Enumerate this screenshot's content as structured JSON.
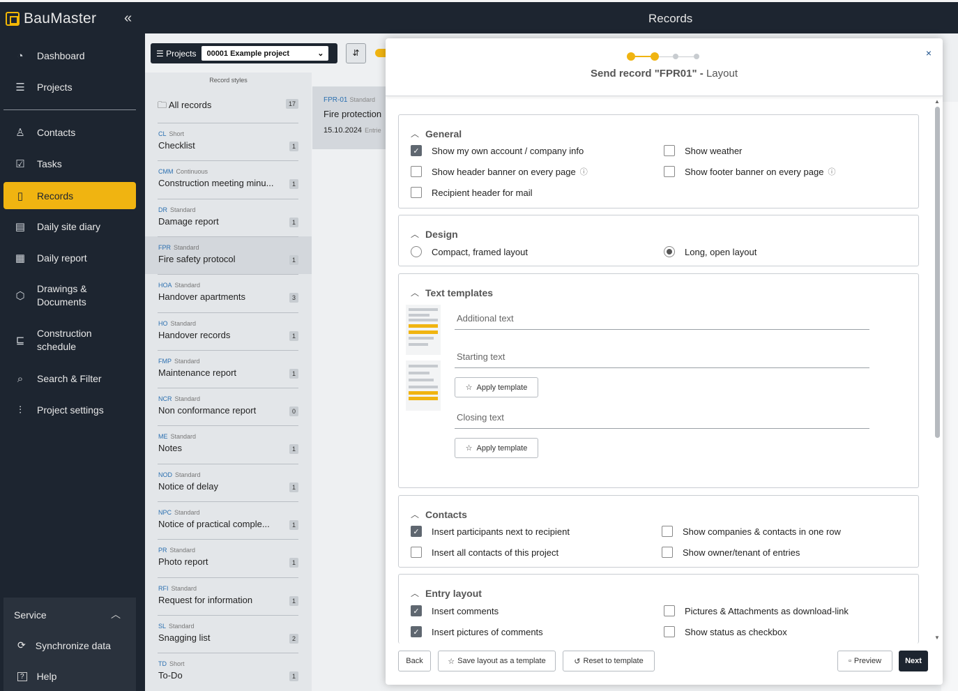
{
  "app": {
    "name": "BauMaster",
    "page_title": "Records"
  },
  "sidebar": {
    "items": [
      {
        "label": "Dashboard",
        "icon": "speedometer-icon"
      },
      {
        "label": "Projects",
        "icon": "list-icon"
      },
      {
        "label": "Contacts",
        "icon": "person-icon"
      },
      {
        "label": "Tasks",
        "icon": "clipboard-check-icon"
      },
      {
        "label": "Records",
        "icon": "clipboard-icon"
      },
      {
        "label": "Daily site diary",
        "icon": "document-icon"
      },
      {
        "label": "Daily report",
        "icon": "building-icon"
      },
      {
        "label": "Drawings &\nDocuments",
        "icon": "cube-icon"
      },
      {
        "label": "Construction\nschedule",
        "icon": "gantt-icon"
      },
      {
        "label": "Search & Filter",
        "icon": "search-document-icon"
      },
      {
        "label": "Project settings",
        "icon": "sliders-icon"
      }
    ],
    "service": {
      "label": "Service",
      "items": [
        {
          "label": "Synchronize data",
          "icon": "sync-icon"
        },
        {
          "label": "Help",
          "icon": "help-icon"
        }
      ]
    }
  },
  "toolbar": {
    "projects_label": "Projects",
    "project_value": "00001 Example project"
  },
  "record_styles": {
    "title": "Record styles",
    "all_label": "All records",
    "all_count": "17",
    "items": [
      {
        "code": "CL",
        "type": "Short",
        "name": "Checklist",
        "count": "1"
      },
      {
        "code": "CMM",
        "type": "Continuous",
        "name": "Construction meeting minu...",
        "count": "1"
      },
      {
        "code": "DR",
        "type": "Standard",
        "name": "Damage report",
        "count": "1"
      },
      {
        "code": "FPR",
        "type": "Standard",
        "name": "Fire safety protocol",
        "count": "1"
      },
      {
        "code": "HOA",
        "type": "Standard",
        "name": "Handover apartments",
        "count": "3"
      },
      {
        "code": "HO",
        "type": "Standard",
        "name": "Handover records",
        "count": "1"
      },
      {
        "code": "FMP",
        "type": "Standard",
        "name": "Maintenance report",
        "count": "1"
      },
      {
        "code": "NCR",
        "type": "Standard",
        "name": "Non conformance report",
        "count": "0"
      },
      {
        "code": "ME",
        "type": "Standard",
        "name": "Notes",
        "count": "1"
      },
      {
        "code": "NOD",
        "type": "Standard",
        "name": "Notice of delay",
        "count": "1"
      },
      {
        "code": "NPC",
        "type": "Standard",
        "name": "Notice of practical comple...",
        "count": "1"
      },
      {
        "code": "PR",
        "type": "Standard",
        "name": "Photo report",
        "count": "1"
      },
      {
        "code": "RFI",
        "type": "Standard",
        "name": "Request for information",
        "count": "1"
      },
      {
        "code": "SL",
        "type": "Standard",
        "name": "Snagging list",
        "count": "2"
      },
      {
        "code": "TD",
        "type": "Short",
        "name": "To-Do",
        "count": "1"
      }
    ]
  },
  "record_card": {
    "code": "FPR-01",
    "type": "Standard",
    "name": "Fire protection",
    "date": "15.10.2024",
    "entries": "Entrie"
  },
  "modal": {
    "title_main": "Send record \"FPR01\"",
    "title_sep": " - ",
    "title_step": "Layout",
    "close": "×",
    "general": {
      "title": "General",
      "options": [
        {
          "label": "Show my own account / company info",
          "checked": true
        },
        {
          "label": "Show weather",
          "checked": false
        },
        {
          "label": "Show header banner on every page",
          "checked": false
        },
        {
          "label": "Show footer banner on every page",
          "checked": false
        },
        {
          "label": "Recipient header for mail",
          "checked": false
        }
      ]
    },
    "design": {
      "title": "Design",
      "options": [
        {
          "label": "Compact, framed layout",
          "selected": false
        },
        {
          "label": "Long, open layout",
          "selected": true
        }
      ]
    },
    "text_templates": {
      "title": "Text templates",
      "additional_text": "Additional text",
      "starting_text": "Starting text",
      "closing_text": "Closing text",
      "apply_label": "Apply template"
    },
    "contacts": {
      "title": "Contacts",
      "options": [
        {
          "label": "Insert participants next to recipient",
          "checked": true
        },
        {
          "label": "Show companies & contacts in one row",
          "checked": false
        },
        {
          "label": "Insert all contacts of this project",
          "checked": false
        },
        {
          "label": "Show owner/tenant of entries",
          "checked": false
        }
      ]
    },
    "entry_layout": {
      "title": "Entry layout",
      "options": [
        {
          "label": "Insert comments",
          "checked": true
        },
        {
          "label": "Pictures & Attachments as download-link",
          "checked": false
        },
        {
          "label": "Insert pictures of comments",
          "checked": true
        },
        {
          "label": "Show status as checkbox",
          "checked": false
        }
      ]
    },
    "footer": {
      "back": "Back",
      "save_template": "Save layout as a template",
      "reset_template": "Reset to template",
      "preview": "Preview",
      "next": "Next"
    }
  },
  "colors": {
    "accent": "#f0b411",
    "dark": "#1d2530",
    "link": "#2a6fb0"
  }
}
